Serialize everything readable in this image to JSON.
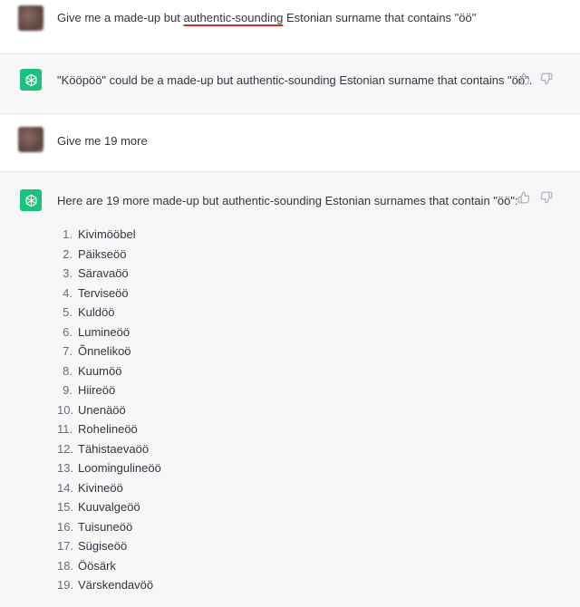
{
  "messages": [
    {
      "role": "user",
      "text_before": "Give me a made-up but ",
      "text_underlined": "authentic-sounding",
      "text_after": " Estonian surname that contains \"öö\""
    },
    {
      "role": "assistant",
      "text": "\"Kööpöö\" could be a made-up but authentic-sounding Estonian surname that contains \"öö\"."
    },
    {
      "role": "user",
      "text": "Give me 19 more"
    },
    {
      "role": "assistant",
      "text": "Here are 19 more made-up but authentic-sounding Estonian surnames that contain \"öö\":"
    }
  ],
  "surnames": [
    {
      "n": "1.",
      "name": "Kivimööbel"
    },
    {
      "n": "2.",
      "name": "Päikseöö"
    },
    {
      "n": "3.",
      "name": "Säravaöö"
    },
    {
      "n": "4.",
      "name": "Terviseöö"
    },
    {
      "n": "5.",
      "name": "Kuldöö"
    },
    {
      "n": "6.",
      "name": "Lumineöö"
    },
    {
      "n": "7.",
      "name": "Õnnelikoö"
    },
    {
      "n": "8.",
      "name": "Kuumöö"
    },
    {
      "n": "9.",
      "name": "Hiireöö"
    },
    {
      "n": "10.",
      "name": "Unenäöö"
    },
    {
      "n": "11.",
      "name": "Rohelineöö"
    },
    {
      "n": "12.",
      "name": "Tähistaevaöö"
    },
    {
      "n": "13.",
      "name": "Loomingulineöö"
    },
    {
      "n": "14.",
      "name": "Kivineöö"
    },
    {
      "n": "15.",
      "name": "Kuuvalgeöö"
    },
    {
      "n": "16.",
      "name": "Tuisuneöö"
    },
    {
      "n": "17.",
      "name": "Sügiseöö"
    },
    {
      "n": "18.",
      "name": "Öösärk"
    },
    {
      "n": "19.",
      "name": "Värskendavöö"
    }
  ],
  "icons": {
    "assistant_avatar": "openai-logo-icon",
    "thumbs_up": "thumbs-up-icon",
    "thumbs_down": "thumbs-down-icon",
    "user_avatar": "user-avatar"
  },
  "colors": {
    "assistant_green": "#19c37d",
    "spell_underline": "#d93025"
  }
}
